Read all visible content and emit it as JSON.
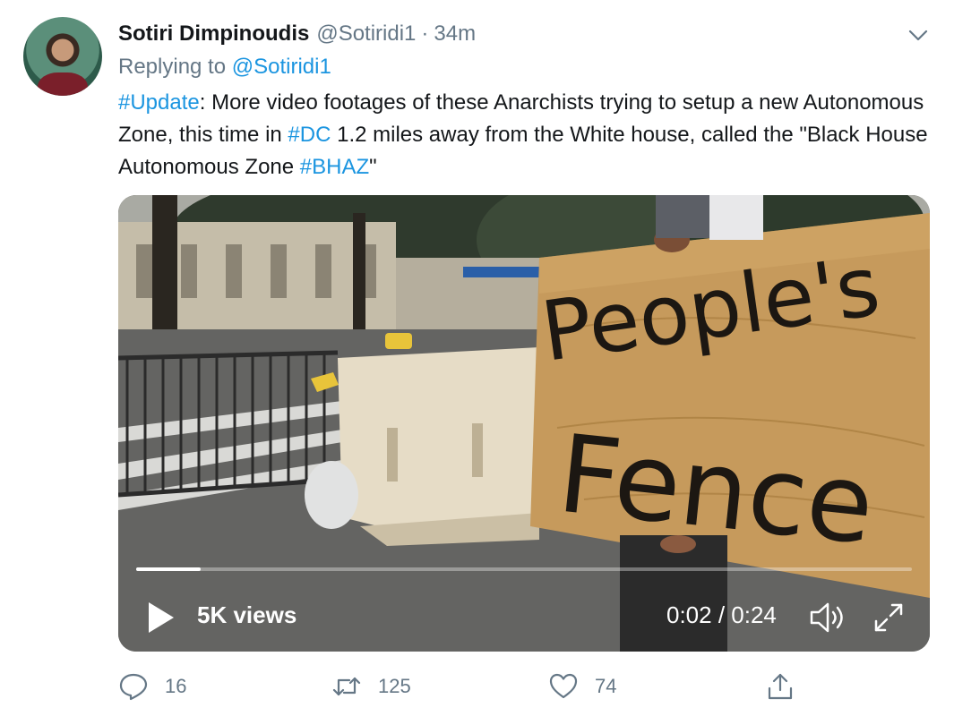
{
  "tweet": {
    "author_name": "Sotiri Dimpinoudis",
    "author_handle": "@Sotiridi1",
    "separator": "·",
    "time": "34m",
    "replying_prefix": "Replying to",
    "replying_handle": "@Sotiridi1",
    "text": {
      "hashtag_update": "#Update",
      "part1": ": More video footages of these Anarchists trying to setup a new Autonomous Zone, this time in ",
      "hashtag_dc": "#DC",
      "part2": " 1.2 miles away from the White house, called the \"Black House Autonomous Zone ",
      "hashtag_bhaz": "#BHAZ",
      "part3": "\""
    }
  },
  "video": {
    "sign_text_line1": "People's",
    "sign_text_line2": "Fence",
    "views_label": "5K views",
    "timecode": "0:02 / 0:24",
    "progress_fraction": 0.083
  },
  "actions": {
    "reply_count": "16",
    "retweet_count": "125",
    "like_count": "74"
  },
  "colors": {
    "link": "#1b95e0",
    "muted": "#657786",
    "text": "#14171a"
  },
  "icons": [
    "chevron-down-icon",
    "play-icon",
    "volume-icon",
    "expand-icon",
    "reply-icon",
    "retweet-icon",
    "like-icon",
    "share-icon"
  ]
}
